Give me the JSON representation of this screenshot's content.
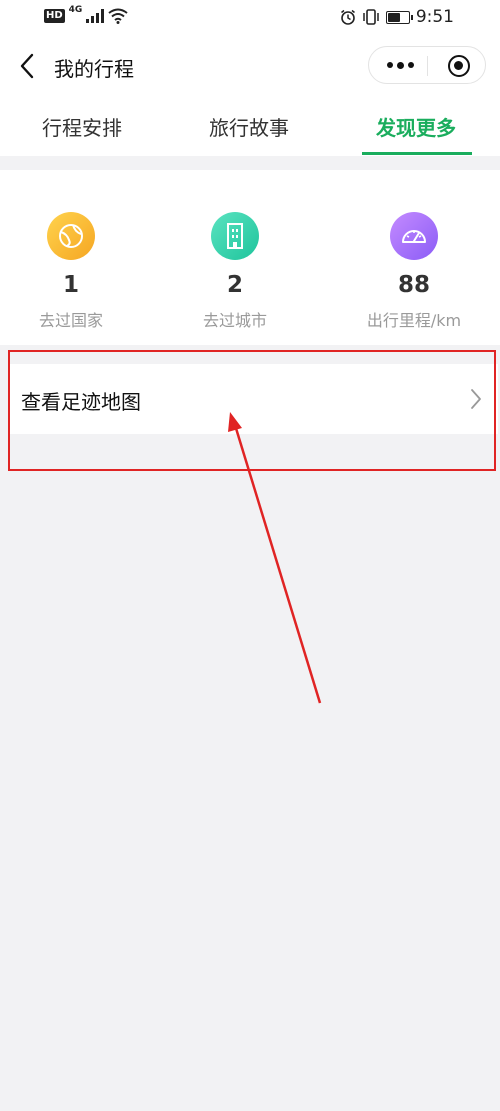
{
  "status_bar": {
    "hd_badge": "HD",
    "network": "4G",
    "time": "9:51"
  },
  "nav": {
    "title": "我的行程"
  },
  "tabs": [
    {
      "label": "行程安排",
      "active": false
    },
    {
      "label": "旅行故事",
      "active": false
    },
    {
      "label": "发现更多",
      "active": true
    }
  ],
  "stats": [
    {
      "value": "1",
      "label": "去过国家",
      "icon": "globe-icon",
      "color_from": "#ffcc44",
      "color_to": "#f5a623"
    },
    {
      "value": "2",
      "label": "去过城市",
      "icon": "building-icon",
      "color_from": "#5ae3c0",
      "color_to": "#22c7a0"
    },
    {
      "value": "88",
      "label": "出行里程/km",
      "icon": "speedometer-icon",
      "color_from": "#c48bff",
      "color_to": "#8b5cf6"
    }
  ],
  "menu": {
    "footprint_map_label": "查看足迹地图"
  },
  "colors": {
    "accent": "#1aad5d",
    "annotation": "#e02424"
  }
}
